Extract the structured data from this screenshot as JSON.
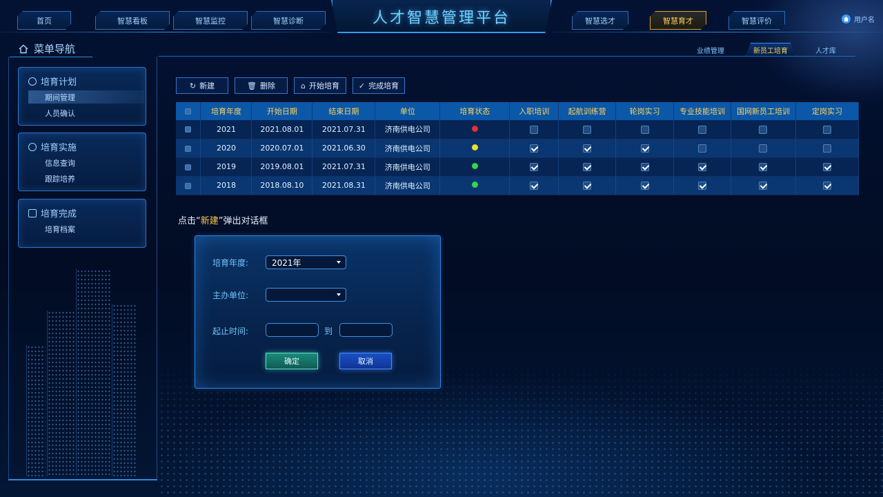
{
  "app": {
    "title": "人才智慧管理平台",
    "user": "用户名"
  },
  "topnav": {
    "left": [
      "首页",
      "智慧看板",
      "智慧监控",
      "智慧诊断"
    ],
    "right": [
      "智慧选才",
      "智慧育才",
      "智慧评价"
    ],
    "active": "智慧育才"
  },
  "subtabs": {
    "items": [
      "业绩管理",
      "新员工培育",
      "人才库"
    ],
    "active": "新员工培育"
  },
  "sidebar": {
    "title": "菜单导航",
    "groups": [
      {
        "label": "培育计划",
        "items": [
          "期间管理",
          "人员确认"
        ],
        "active_item": "期间管理"
      },
      {
        "label": "培育实施",
        "items": [
          "信息查询",
          "跟踪培养"
        ]
      },
      {
        "label": "培育完成",
        "items": [
          "培育档案"
        ]
      }
    ]
  },
  "toolbar": {
    "new": "新建",
    "delete": "删除",
    "start": "开始培育",
    "complete": "完成培育"
  },
  "table": {
    "headers": [
      "培育年度",
      "开始日期",
      "结束日期",
      "单位",
      "培育状态",
      "入职培训",
      "起航训练营",
      "轮岗实习",
      "专业技能培训",
      "国网新员工培训",
      "定岗实习"
    ],
    "rows": [
      {
        "year": "2021",
        "start": "2021.08.01",
        "end": "2021.07.31",
        "unit": "济南供电公司",
        "status": "red",
        "checks": [
          false,
          false,
          false,
          false,
          false,
          false
        ]
      },
      {
        "year": "2020",
        "start": "2020.07.01",
        "end": "2021.06.30",
        "unit": "济南供电公司",
        "status": "yellow",
        "checks": [
          true,
          true,
          true,
          false,
          false,
          false
        ]
      },
      {
        "year": "2019",
        "start": "2019.08.01",
        "end": "2021.07.31",
        "unit": "济南供电公司",
        "status": "green",
        "checks": [
          true,
          true,
          true,
          true,
          true,
          true
        ]
      },
      {
        "year": "2018",
        "start": "2018.08.10",
        "end": "2021.08.31",
        "unit": "济南供电公司",
        "status": "green",
        "checks": [
          true,
          true,
          true,
          true,
          true,
          true
        ]
      }
    ]
  },
  "hint": {
    "prefix": "点击“",
    "highlight": "新建",
    "suffix": "”弹出对话框"
  },
  "dialog": {
    "year_label": "培育年度:",
    "year_value": "2021年",
    "unit_label": "主办单位:",
    "unit_value": "",
    "period_label": "起止时间:",
    "to_label": "到",
    "start_value": "",
    "end_value": "",
    "ok": "确定",
    "cancel": "取消"
  },
  "colors": {
    "status_red": "#e53030",
    "status_yellow": "#f2dc2a",
    "status_green": "#34d64a",
    "accent": "#ffd35a"
  }
}
